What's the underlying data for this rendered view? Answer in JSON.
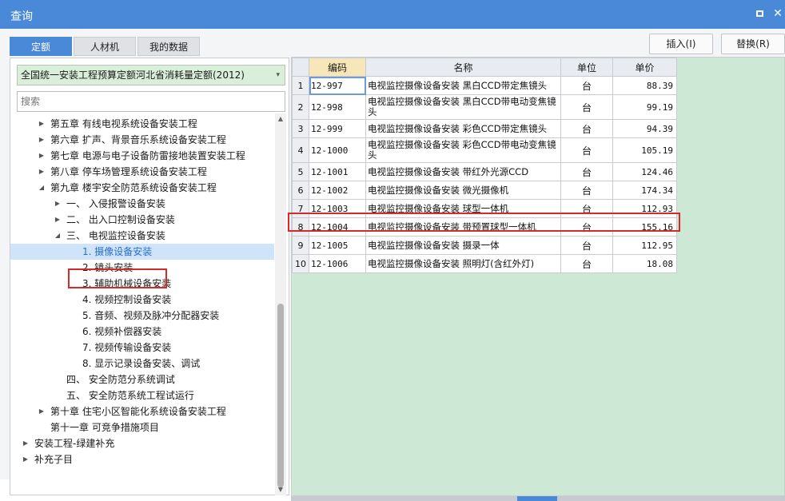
{
  "window": {
    "title": "查询"
  },
  "tabs": [
    {
      "label": "定额"
    },
    {
      "label": "人材机"
    },
    {
      "label": "我的数据"
    }
  ],
  "actions": {
    "insert_label": "插入(I)",
    "replace_label": "替换(R)"
  },
  "left": {
    "quota_selected": "全国统一安装工程预算定额河北省消耗量定额(2012)",
    "search_placeholder": "搜索",
    "tree": [
      {
        "label": "第五章 有线电视系统设备安装工程",
        "level": 1,
        "arrow": "right"
      },
      {
        "label": "第六章 扩声、背景音乐系统设备安装工程",
        "level": 1,
        "arrow": "right"
      },
      {
        "label": "第七章 电源与电子设备防雷接地装置安装工程",
        "level": 1,
        "arrow": "right"
      },
      {
        "label": "第八章 停车场管理系统设备安装工程",
        "level": 1,
        "arrow": "right"
      },
      {
        "label": "第九章 楼宇安全防范系统设备安装工程",
        "level": 1,
        "arrow": "down"
      },
      {
        "label": "一、 入侵报警设备安装",
        "level": 2,
        "arrow": "right"
      },
      {
        "label": "二、 出入口控制设备安装",
        "level": 2,
        "arrow": "right"
      },
      {
        "label": "三、 电视监控设备安装",
        "level": 2,
        "arrow": "down"
      },
      {
        "label": "1. 摄像设备安装",
        "level": 3,
        "arrow": "",
        "selected": true
      },
      {
        "label": "2. 镜头安装",
        "level": 3,
        "arrow": ""
      },
      {
        "label": "3. 辅助机械设备安装",
        "level": 3,
        "arrow": ""
      },
      {
        "label": "4. 视频控制设备安装",
        "level": 3,
        "arrow": ""
      },
      {
        "label": "5. 音频、视频及脉冲分配器安装",
        "level": 3,
        "arrow": ""
      },
      {
        "label": "6. 视频补偿器安装",
        "level": 3,
        "arrow": ""
      },
      {
        "label": "7. 视频传输设备安装",
        "level": 3,
        "arrow": ""
      },
      {
        "label": "8. 显示记录设备安装、调试",
        "level": 3,
        "arrow": ""
      },
      {
        "label": "四、 安全防范分系统调试",
        "level": 2,
        "arrow": ""
      },
      {
        "label": "五、 安全防范系统工程试运行",
        "level": 2,
        "arrow": ""
      },
      {
        "label": "第十章 住宅小区智能化系统设备安装工程",
        "level": 1,
        "arrow": "right"
      },
      {
        "label": "第十一章 可竞争措施项目",
        "level": 1,
        "arrow": ""
      },
      {
        "label": "安装工程-绿建补充",
        "level": 0,
        "arrow": "right"
      },
      {
        "label": "补充子目",
        "level": 0,
        "arrow": "right"
      }
    ]
  },
  "grid": {
    "columns": [
      "编码",
      "名称",
      "单位",
      "单价"
    ],
    "rows": [
      {
        "no": "1",
        "code": "12-997",
        "name": "电视监控摄像设备安装 黑白CCD带定焦镜头",
        "unit": "台",
        "price": "88.39"
      },
      {
        "no": "2",
        "code": "12-998",
        "name": "电视监控摄像设备安装 黑白CCD带电动变焦镜头",
        "unit": "台",
        "price": "99.19"
      },
      {
        "no": "3",
        "code": "12-999",
        "name": "电视监控摄像设备安装 彩色CCD带定焦镜头",
        "unit": "台",
        "price": "94.39"
      },
      {
        "no": "4",
        "code": "12-1000",
        "name": "电视监控摄像设备安装 彩色CCD带电动变焦镜头",
        "unit": "台",
        "price": "105.19"
      },
      {
        "no": "5",
        "code": "12-1001",
        "name": "电视监控摄像设备安装 带红外光源CCD",
        "unit": "台",
        "price": "124.46"
      },
      {
        "no": "6",
        "code": "12-1002",
        "name": "电视监控摄像设备安装 微光摄像机",
        "unit": "台",
        "price": "174.34"
      },
      {
        "no": "7",
        "code": "12-1003",
        "name": "电视监控摄像设备安装 球型一体机",
        "unit": "台",
        "price": "112.93"
      },
      {
        "no": "8",
        "code": "12-1004",
        "name": "电视监控摄像设备安装 带预置球型一体机",
        "unit": "台",
        "price": "155.16"
      },
      {
        "no": "9",
        "code": "12-1005",
        "name": "电视监控摄像设备安装 摄录一体",
        "unit": "台",
        "price": "112.95"
      },
      {
        "no": "10",
        "code": "12-1006",
        "name": "电视监控摄像设备安装 照明灯(含红外灯)",
        "unit": "台",
        "price": "18.08"
      }
    ]
  }
}
